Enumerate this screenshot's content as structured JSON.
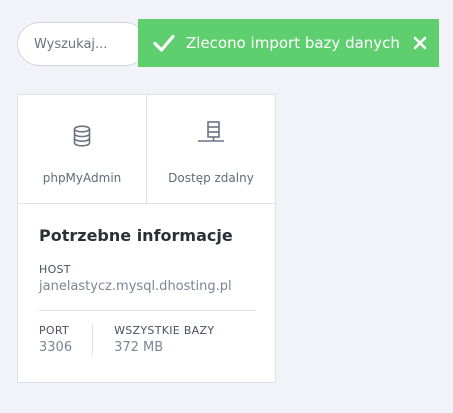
{
  "search": {
    "placeholder": "Wyszukaj..."
  },
  "toast": {
    "message": "Zlecono import bazy danych",
    "icon": "check-icon",
    "close_icon": "close-icon",
    "color": "#5fce6f"
  },
  "card": {
    "tiles": [
      {
        "label": "phpMyAdmin",
        "icon": "database-icon"
      },
      {
        "label": "Dostęp zdalny",
        "icon": "remote-server-icon"
      }
    ],
    "info": {
      "title": "Potrzebne informacje",
      "host_label": "HOST",
      "host_value": "janelastycz.mysql.dhosting.pl",
      "port_label": "PORT",
      "port_value": "3306",
      "db_label": "WSZYSTKIE BAZY",
      "db_value": "372 MB"
    }
  }
}
